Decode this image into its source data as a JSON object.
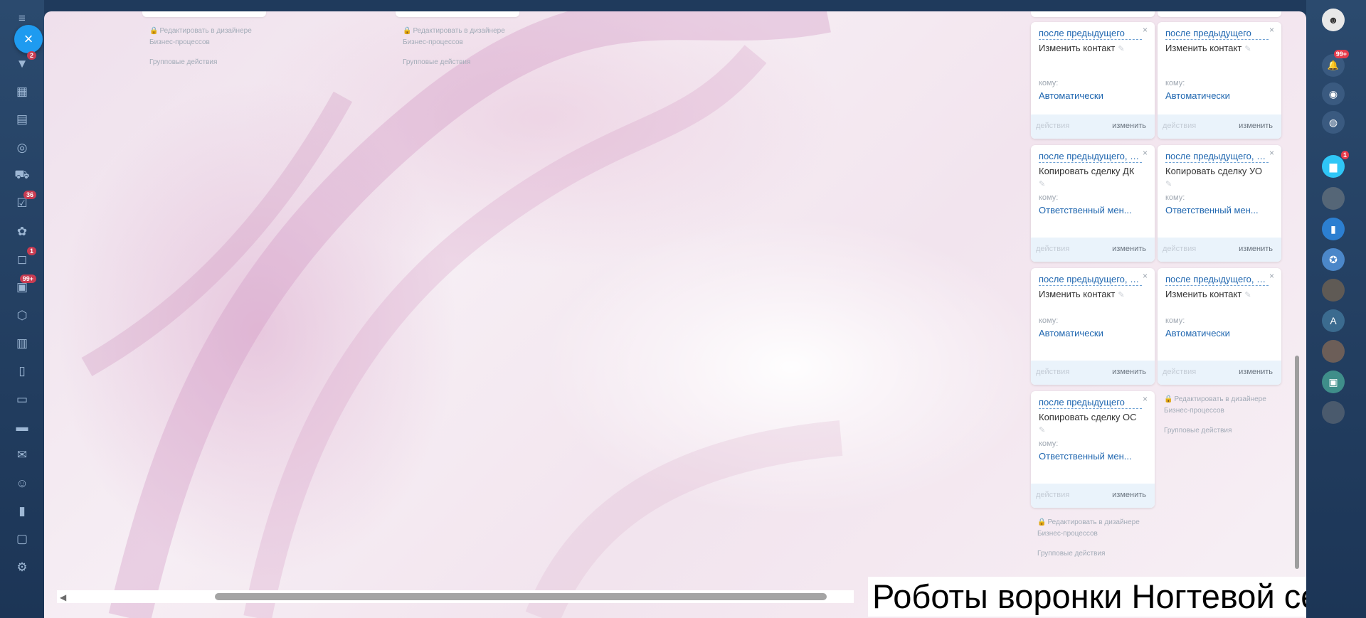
{
  "left_rail": {
    "close_icon": "×",
    "items": [
      {
        "name": "menu-icon",
        "glyph": "≡",
        "badge": ""
      },
      {
        "name": "funnel-icon",
        "glyph": "▼",
        "badge": "2"
      },
      {
        "name": "calendar-icon",
        "glyph": "▦",
        "badge": ""
      },
      {
        "name": "store-icon",
        "glyph": "▤",
        "badge": ""
      },
      {
        "name": "target-icon",
        "glyph": "◎",
        "badge": ""
      },
      {
        "name": "cart-icon",
        "glyph": "⛟",
        "badge": ""
      },
      {
        "name": "tasks-icon",
        "glyph": "☑",
        "badge": "36"
      },
      {
        "name": "integration-icon",
        "glyph": "✿",
        "badge": ""
      },
      {
        "name": "chat-icon",
        "glyph": "◻",
        "badge": "1"
      },
      {
        "name": "feed-icon",
        "glyph": "▣",
        "badge": "99+"
      },
      {
        "name": "shield-icon",
        "glyph": "⬡",
        "badge": ""
      },
      {
        "name": "schedule-icon",
        "glyph": "▥",
        "badge": ""
      },
      {
        "name": "document-icon",
        "glyph": "▯",
        "badge": ""
      },
      {
        "name": "monitor-icon",
        "glyph": "▭",
        "badge": ""
      },
      {
        "name": "inbox-icon",
        "glyph": "▬",
        "badge": ""
      },
      {
        "name": "mail-icon",
        "glyph": "✉",
        "badge": ""
      },
      {
        "name": "users-icon",
        "glyph": "☺",
        "badge": ""
      },
      {
        "name": "analytics-icon",
        "glyph": "▮",
        "badge": ""
      },
      {
        "name": "sites-icon",
        "glyph": "▢",
        "badge": ""
      },
      {
        "name": "settings-icon",
        "glyph": "⚙",
        "badge": ""
      }
    ]
  },
  "right_rail": {
    "items": [
      {
        "name": "profile-avatar",
        "glyph": "☻",
        "bg": "#e8e8e8",
        "badge": ""
      },
      {
        "name": "notifications-icon",
        "glyph": "🔔",
        "bg": "#3a5a80",
        "badge": "99+"
      },
      {
        "name": "fingerprint-icon",
        "glyph": "◉",
        "bg": "#3a5a80",
        "badge": ""
      },
      {
        "name": "chat-search-icon",
        "glyph": "◍",
        "bg": "#3a5a80",
        "badge": ""
      },
      {
        "name": "messenger-icon",
        "glyph": "▆",
        "bg": "#2fc6f6",
        "badge": "1"
      },
      {
        "name": "contact-avatar-1",
        "glyph": "",
        "bg": "#556677",
        "badge": ""
      },
      {
        "name": "bookmark-icon",
        "glyph": "▮",
        "bg": "#2c7fd1",
        "badge": ""
      },
      {
        "name": "contact-avatar-2",
        "glyph": "✪",
        "bg": "#4b87c9",
        "badge": ""
      },
      {
        "name": "contact-avatar-3",
        "glyph": "",
        "bg": "#5f5a55",
        "badge": ""
      },
      {
        "name": "contact-avatar-a",
        "glyph": "A",
        "bg": "#3b6b8f",
        "badge": ""
      },
      {
        "name": "contact-avatar-4",
        "glyph": "",
        "bg": "#6c5e58",
        "badge": ""
      },
      {
        "name": "contact-avatar-5",
        "glyph": "▣",
        "bg": "#3f8e8a",
        "badge": ""
      },
      {
        "name": "contact-avatar-6",
        "glyph": "",
        "bg": "#4a5a6d",
        "badge": ""
      }
    ]
  },
  "edit_blocks": {
    "col1": {
      "line1": "Редактировать в дизайнере",
      "line2": "Бизнес-процессов",
      "group": "Групповые действия"
    },
    "col2": {
      "line1": "Редактировать в дизайнере",
      "line2": "Бизнес-процессов",
      "group": "Групповые действия"
    },
    "col3": {
      "line1": "Редактировать в дизайнере",
      "line2": "Бизнес-процессов",
      "group": "Групповые действия"
    },
    "col4": {
      "line1": "Редактировать в дизайнере",
      "line2": "Бизнес-процессов",
      "group": "Групповые действия"
    }
  },
  "cards": [
    {
      "trigger": "после предыдущего",
      "title": "Изменить контакт",
      "to_label": "кому:",
      "to_value": "Автоматически",
      "actions": "действия",
      "change": "изменить",
      "close": "×",
      "pencil": "✎"
    },
    {
      "trigger": "после предыдущего",
      "title": "Изменить контакт",
      "to_label": "кому:",
      "to_value": "Автоматически",
      "actions": "действия",
      "change": "изменить",
      "close": "×",
      "pencil": "✎"
    },
    {
      "trigger": "после предыдущего, п...",
      "title": "Копировать сделку ДК",
      "to_label": "кому:",
      "to_value": "Ответственный мен...",
      "actions": "действия",
      "change": "изменить",
      "close": "×",
      "pencil": "✎"
    },
    {
      "trigger": "после предыдущего, п...",
      "title": "Копировать сделку УО",
      "to_label": "кому:",
      "to_value": "Ответственный мен...",
      "actions": "действия",
      "change": "изменить",
      "close": "×",
      "pencil": "✎"
    },
    {
      "trigger": "после предыдущего, п...",
      "title": "Изменить контакт",
      "to_label": "кому:",
      "to_value": "Автоматически",
      "actions": "действия",
      "change": "изменить",
      "close": "×",
      "pencil": "✎"
    },
    {
      "trigger": "после предыдущего, п...",
      "title": "Изменить контакт",
      "to_label": "кому:",
      "to_value": "Автоматически",
      "actions": "действия",
      "change": "изменить",
      "close": "×",
      "pencil": "✎"
    },
    {
      "trigger": "после предыдущего",
      "title": "Копировать сделку ОС",
      "to_label": "кому:",
      "to_value": "Ответственный мен...",
      "actions": "действия",
      "change": "изменить",
      "close": "×",
      "pencil": "✎"
    }
  ],
  "scroll": {
    "left_arrow": "◀"
  },
  "caption": "Роботы воронки Ногтевой сервис"
}
